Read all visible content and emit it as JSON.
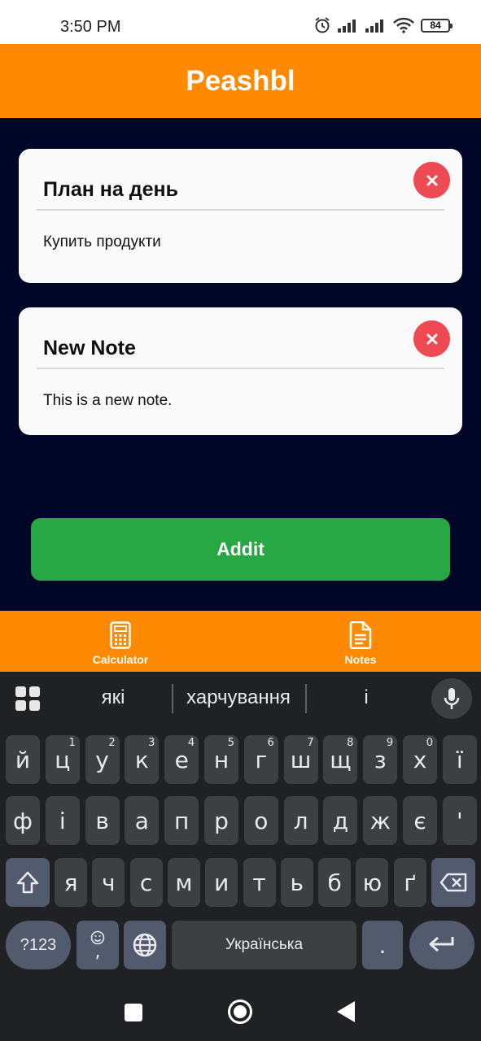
{
  "status": {
    "time": "3:50 PM",
    "battery": "84"
  },
  "app": {
    "title": "Peashbl"
  },
  "notes": [
    {
      "title": "План на день",
      "body": "Купить продукти"
    },
    {
      "title": "New Note",
      "body": "This is a new note."
    }
  ],
  "add_button": {
    "label": "Addit"
  },
  "tabs": [
    {
      "label": "Calculator",
      "icon": "calculator-icon"
    },
    {
      "label": "Notes",
      "icon": "document-icon"
    }
  ],
  "keyboard": {
    "suggestions": [
      "які",
      "харчування",
      "і"
    ],
    "row1": [
      "й",
      "ц",
      "у",
      "к",
      "е",
      "н",
      "г",
      "ш",
      "щ",
      "з",
      "х",
      "ї"
    ],
    "row1_hints": [
      "",
      "1",
      "2",
      "3",
      "4",
      "5",
      "6",
      "7",
      "8",
      "9",
      "0",
      ""
    ],
    "row2": [
      "ф",
      "і",
      "в",
      "а",
      "п",
      "р",
      "о",
      "л",
      "д",
      "ж",
      "є",
      "'"
    ],
    "row3": [
      "я",
      "ч",
      "с",
      "м",
      "и",
      "т",
      "ь",
      "б",
      "ю",
      "ґ"
    ],
    "symbols_label": "?123",
    "emoji_comma": ",",
    "space_label": "Українська",
    "period": "."
  },
  "colors": {
    "accent": "#fe8902",
    "background": "#000628",
    "delete": "#ee4a54",
    "add": "#28a745"
  }
}
